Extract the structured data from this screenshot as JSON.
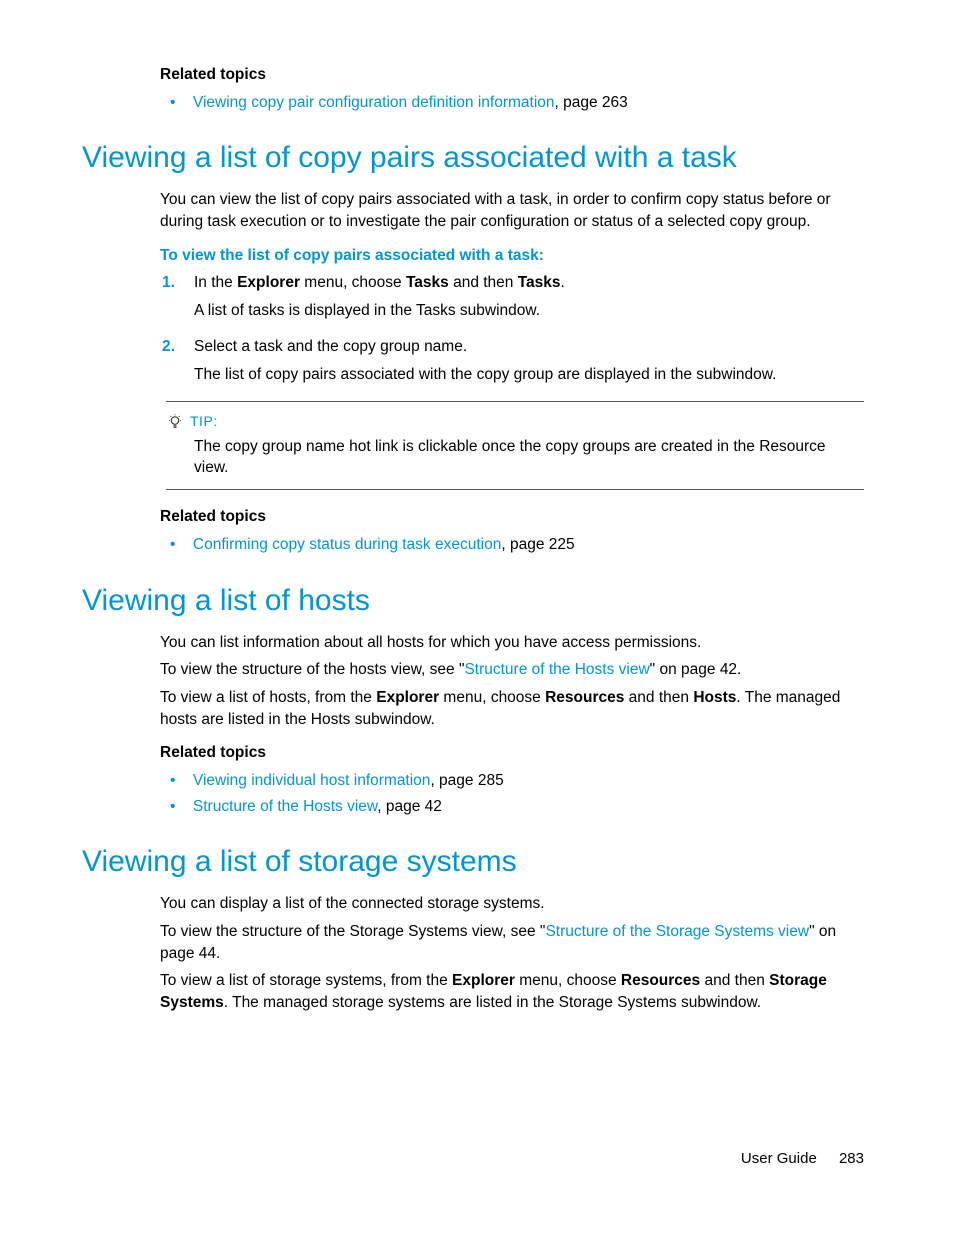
{
  "top_related": {
    "heading": "Related topics",
    "items": [
      {
        "link": "Viewing copy pair configuration definition information",
        "suffix": ", page 263"
      }
    ]
  },
  "section1": {
    "title": "Viewing a list of copy pairs associated with a task",
    "p1": "You can view the list of copy pairs associated with a task, in order to confirm copy status before or during task execution or to investigate the pair configuration or status of a selected copy group.",
    "proc_intro": "To view the list of copy pairs associated with a task:",
    "step1_a": "In the ",
    "step1_b": "Explorer",
    "step1_c": " menu, choose ",
    "step1_d": "Tasks",
    "step1_e": " and then ",
    "step1_f": "Tasks",
    "step1_g": ".",
    "step1_p": "A list of tasks is displayed in the Tasks subwindow.",
    "step2_a": "Select a task and the copy group name.",
    "step2_p": "The list of copy pairs associated with the copy group are displayed in the subwindow.",
    "tip_label": "TIP:",
    "tip_body": "The copy group name hot link is clickable once the copy groups are created in the Resource view.",
    "related_heading": "Related topics",
    "related_items": [
      {
        "link": "Confirming copy status during task execution",
        "suffix": ", page 225"
      }
    ]
  },
  "section2": {
    "title": "Viewing a list of hosts",
    "p1": "You can list information about all hosts for which you have access permissions.",
    "p2_a": "To view the structure of the hosts view, see \"",
    "p2_link": "Structure of the Hosts view",
    "p2_b": "\" on page 42.",
    "p3_a": "To view a list of hosts, from the ",
    "p3_b": "Explorer",
    "p3_c": " menu, choose ",
    "p3_d": "Resources",
    "p3_e": " and then ",
    "p3_f": "Hosts",
    "p3_g": ". The managed hosts are listed in the Hosts subwindow.",
    "related_heading": "Related topics",
    "related_items": [
      {
        "link": "Viewing individual host information",
        "suffix": ", page 285"
      },
      {
        "link": "Structure of the Hosts view",
        "suffix": ", page 42"
      }
    ]
  },
  "section3": {
    "title": "Viewing a list of storage systems",
    "p1": "You can display a list of the connected storage systems.",
    "p2_a": "To view the structure of the Storage Systems view, see  \"",
    "p2_link": "Structure of the Storage Systems view",
    "p2_b": "\" on page 44.",
    "p3_a": "To view a list of storage systems, from the ",
    "p3_b": "Explorer",
    "p3_c": " menu, choose ",
    "p3_d": "Resources",
    "p3_e": " and then ",
    "p3_f": "Storage Systems",
    "p3_g": ". The managed storage systems are listed in the Storage Systems subwindow."
  },
  "footer": {
    "label": "User Guide",
    "page": "283"
  }
}
